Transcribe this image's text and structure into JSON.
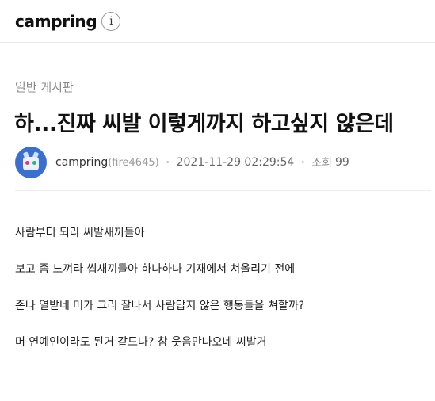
{
  "header": {
    "brand": "campring",
    "info_label": "i"
  },
  "post": {
    "board": "일반 게시판",
    "title": "하...진짜 씨발 이렇게까지 하고싶지 않은데",
    "author_name": "campring",
    "author_id": "(fire4645)",
    "separator": "•",
    "date": "2021-11-29 02:29:54",
    "views_label": "조회",
    "views": "99",
    "body": [
      "사람부터 되라 씨발새끼들아",
      "보고 좀 느껴라 씹새끼들아 하나하나 기재에서 쳐올리기 전에",
      "존나 열받네  머가 그리 잘나서 사람답지 않은 행동들을 쳐할까?",
      "머 연예인이라도 된거 같드나? 참 웃음만나오네 씨발거"
    ]
  }
}
